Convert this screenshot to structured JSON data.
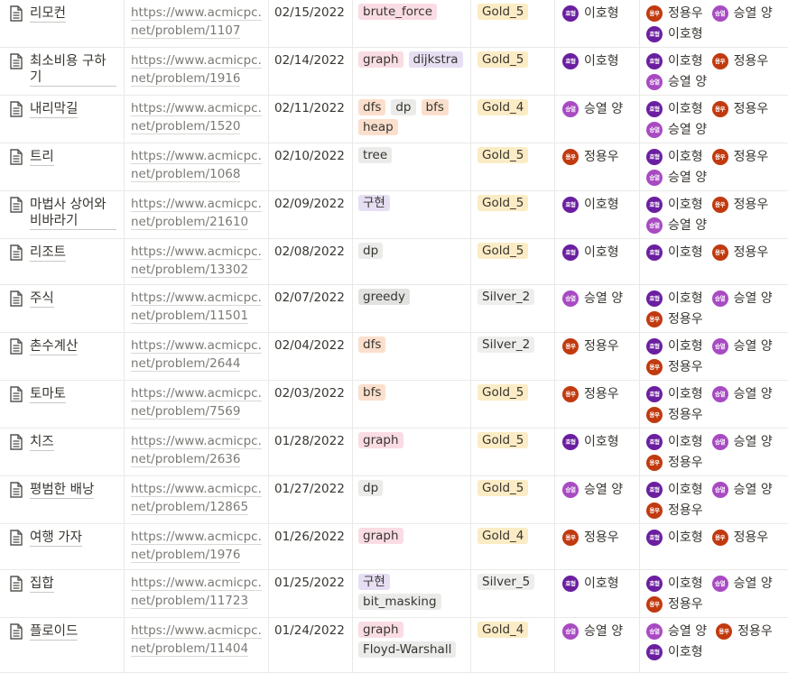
{
  "colors": {
    "tags": {
      "brute_force": "#fadce4",
      "graph": "#fadce4",
      "dijkstra": "#e6def3",
      "dfs": "#fbdfcd",
      "dp": "#ebebea",
      "bfs": "#fbdfcd",
      "heap": "#fbdfcd",
      "tree": "#ebebea",
      "구현": "#e6def3",
      "greedy": "#e2e2e1",
      "bit_masking": "#ebebea",
      "Floyd-Warshall": "#ebebea"
    },
    "tiers": {
      "Gold_5": "#fbecc5",
      "Gold_4": "#fbecc5",
      "Silver_2": "#eeeeed",
      "Silver_5": "#eeeeed"
    },
    "avatars": {
      "이호형": "#6b1fa0",
      "정용우": "#c13a0f",
      "승열 양": "#a84bc2"
    },
    "avatar_initials": {
      "이호형": "호형",
      "정용우": "용우",
      "승열 양": "승열"
    }
  },
  "rows": [
    {
      "title": "리모컨",
      "link": "https://www.acmicpc.net/problem/1107",
      "date": "02/15/2022",
      "tags": [
        "brute_force"
      ],
      "tier": "Gold_5",
      "solver": "이호형",
      "people": [
        "정용우",
        "승열 양",
        "이호형"
      ]
    },
    {
      "title": "최소비용 구하기",
      "link": "https://www.acmicpc.net/problem/1916",
      "date": "02/14/2022",
      "tags": [
        "graph",
        "dijkstra"
      ],
      "tier": "Gold_5",
      "solver": "이호형",
      "people": [
        "이호형",
        "정용우",
        "승열 양"
      ]
    },
    {
      "title": "내리막길",
      "link": "https://www.acmicpc.net/problem/1520",
      "date": "02/11/2022",
      "tags": [
        "dfs",
        "dp",
        "bfs",
        "heap"
      ],
      "tier": "Gold_4",
      "solver": "승열 양",
      "people": [
        "이호형",
        "정용우",
        "승열 양"
      ]
    },
    {
      "title": "트리",
      "link": "https://www.acmicpc.net/problem/1068",
      "date": "02/10/2022",
      "tags": [
        "tree"
      ],
      "tier": "Gold_5",
      "solver": "정용우",
      "people": [
        "이호형",
        "정용우",
        "승열 양"
      ]
    },
    {
      "title": "마법사 상어와 비바라기",
      "link": "https://www.acmicpc.net/problem/21610",
      "date": "02/09/2022",
      "tags": [
        "구현"
      ],
      "tier": "Gold_5",
      "solver": "이호형",
      "people": [
        "이호형",
        "정용우",
        "승열 양"
      ]
    },
    {
      "title": "리조트",
      "link": "https://www.acmicpc.net/problem/13302",
      "date": "02/08/2022",
      "tags": [
        "dp"
      ],
      "tier": "Gold_5",
      "solver": "이호형",
      "people": [
        "이호형",
        "정용우"
      ]
    },
    {
      "title": "주식",
      "link": "https://www.acmicpc.net/problem/11501",
      "date": "02/07/2022",
      "tags": [
        "greedy"
      ],
      "tier": "Silver_2",
      "solver": "승열 양",
      "people": [
        "이호형",
        "승열 양",
        "정용우"
      ]
    },
    {
      "title": "촌수계산",
      "link": "https://www.acmicpc.net/problem/2644",
      "date": "02/04/2022",
      "tags": [
        "dfs"
      ],
      "tier": "Silver_2",
      "solver": "정용우",
      "people": [
        "이호형",
        "승열 양",
        "정용우"
      ]
    },
    {
      "title": "토마토",
      "link": "https://www.acmicpc.net/problem/7569",
      "date": "02/03/2022",
      "tags": [
        "bfs"
      ],
      "tier": "Gold_5",
      "solver": "정용우",
      "people": [
        "이호형",
        "승열 양",
        "정용우"
      ]
    },
    {
      "title": "치즈",
      "link": "https://www.acmicpc.net/problem/2636",
      "date": "01/28/2022",
      "tags": [
        "graph"
      ],
      "tier": "Gold_5",
      "solver": "이호형",
      "people": [
        "이호형",
        "승열 양",
        "정용우"
      ]
    },
    {
      "title": "평범한 배낭",
      "link": "https://www.acmicpc.net/problem/12865",
      "date": "01/27/2022",
      "tags": [
        "dp"
      ],
      "tier": "Gold_5",
      "solver": "승열 양",
      "people": [
        "이호형",
        "승열 양",
        "정용우"
      ]
    },
    {
      "title": "여행 가자",
      "link": "https://www.acmicpc.net/problem/1976",
      "date": "01/26/2022",
      "tags": [
        "graph"
      ],
      "tier": "Gold_4",
      "solver": "정용우",
      "people": [
        "이호형",
        "정용우"
      ]
    },
    {
      "title": "집합",
      "link": "https://www.acmicpc.net/problem/11723",
      "date": "01/25/2022",
      "tags": [
        "구현",
        "bit_masking"
      ],
      "tier": "Silver_5",
      "solver": "이호형",
      "people": [
        "이호형",
        "승열 양",
        "정용우"
      ]
    },
    {
      "title": "플로이드",
      "link": "https://www.acmicpc.net/problem/11404",
      "date": "01/24/2022",
      "tags": [
        "graph",
        "Floyd-Warshall"
      ],
      "tier": "Gold_4",
      "solver": "승열 양",
      "people": [
        "승열 양",
        "정용우",
        "이호형"
      ]
    }
  ]
}
